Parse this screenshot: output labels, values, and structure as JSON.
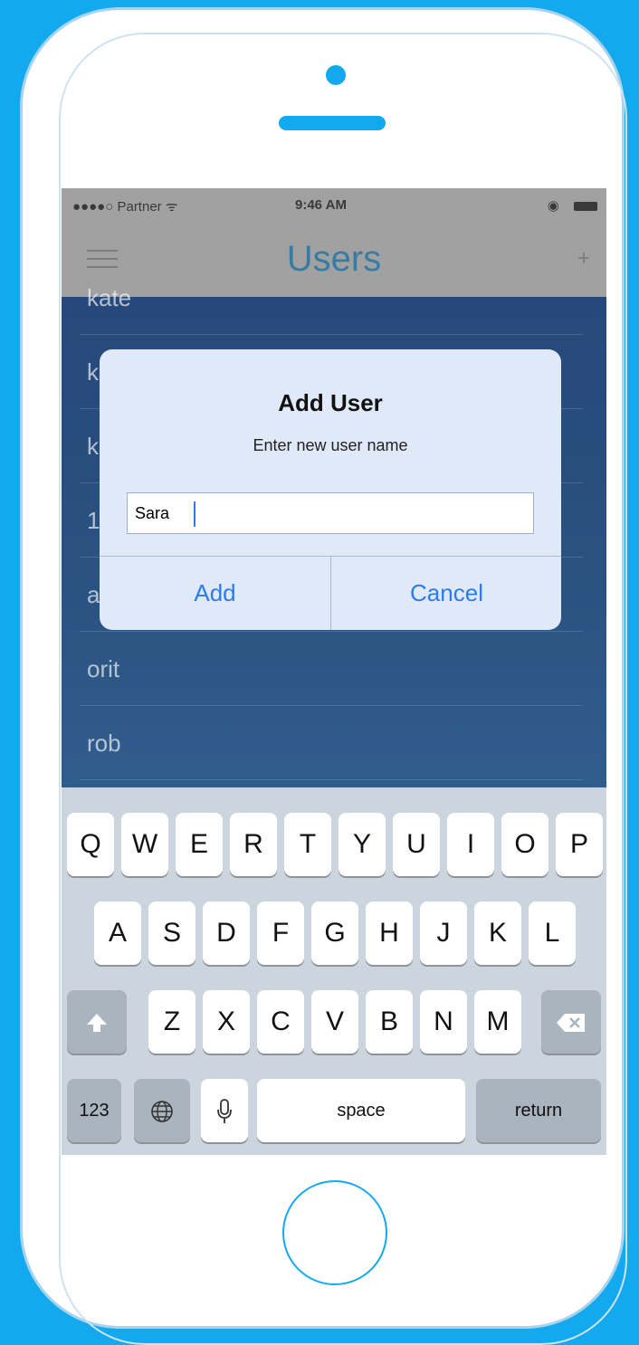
{
  "status_bar": {
    "carrier": "●●●●○ Partner ᯤ",
    "time": "9:46 AM",
    "icons": "◉"
  },
  "nav": {
    "title": "Users",
    "menu_icon": "hamburger-icon",
    "add_label": "+"
  },
  "users": [
    "kate",
    "k",
    "k",
    "1",
    "a",
    "orit",
    "rob"
  ],
  "dialog": {
    "title": "Add User",
    "message": "Enter new user name",
    "input_value": "Sara",
    "add_label": "Add",
    "cancel_label": "Cancel"
  },
  "keyboard": {
    "row1": [
      "Q",
      "W",
      "E",
      "R",
      "T",
      "Y",
      "U",
      "I",
      "O",
      "P"
    ],
    "row2": [
      "A",
      "S",
      "D",
      "F",
      "G",
      "H",
      "J",
      "K",
      "L"
    ],
    "row3": [
      "Z",
      "X",
      "C",
      "V",
      "B",
      "N",
      "M"
    ],
    "shift": "shift-icon",
    "backspace": "backspace-icon",
    "numbers": "123",
    "globe": "globe-icon",
    "mic": "microphone-icon",
    "space": "space",
    "return": "return"
  },
  "colors": {
    "background": "#13a9ee",
    "accent": "#2a7cf0",
    "title": "#1d6b94"
  }
}
